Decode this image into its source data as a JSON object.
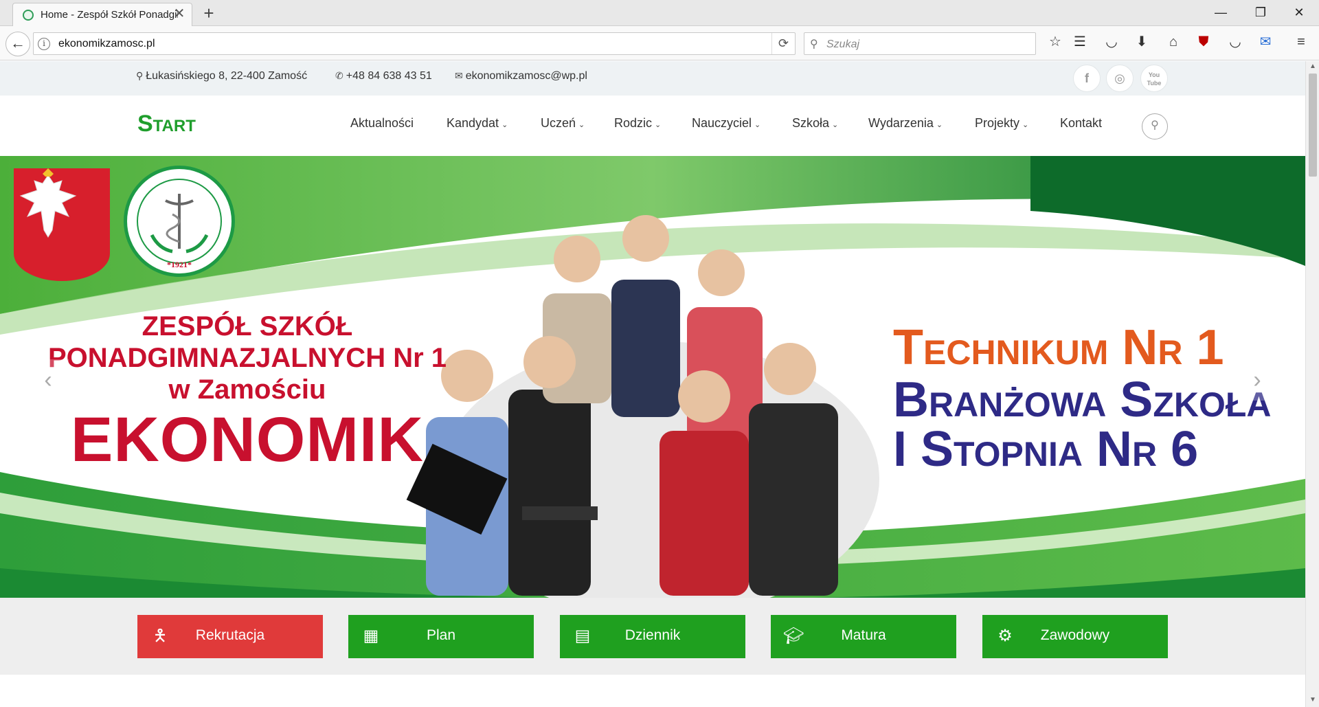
{
  "browser": {
    "tab_title": "Home - Zespół Szkół Ponadgimnazjalnych",
    "tab_close": "✕",
    "new_tab": "+",
    "url": "ekonomikzamosc.pl",
    "search_placeholder": "Szukaj",
    "win_min": "—",
    "win_max": "❐",
    "win_close": "✕"
  },
  "contact": {
    "address": "Łukasińskiego 8, 22-400 Zamość",
    "phone": "+48 84 638 43 51",
    "email": "ekonomikzamosc@wp.pl"
  },
  "social": {
    "facebook": "f",
    "instagram": "◎",
    "youtube": "You Tube"
  },
  "nav": {
    "logo": "Start",
    "items": [
      {
        "label": "Aktualności"
      },
      {
        "label": "Kandydat"
      },
      {
        "label": "Uczeń"
      },
      {
        "label": "Rodzic"
      },
      {
        "label": "Nauczyciel"
      },
      {
        "label": "Szkoła"
      },
      {
        "label": "Wydarzenia"
      },
      {
        "label": "Projekty"
      },
      {
        "label": "Kontakt"
      }
    ]
  },
  "hero": {
    "left_line1": "ZESPÓŁ SZKÓŁ",
    "left_line2": "PONADGIMNAZJALNYCH Nr 1",
    "left_line3": "w Zamościu",
    "left_big": "EKONOMIK",
    "right_line1": "Technikum Nr 1",
    "right_line2": "Branżowa Szkoła",
    "right_line3": "I Stopnia Nr 6",
    "seal_year": "*1921*",
    "prev_arrow": "‹",
    "next_arrow": "›"
  },
  "quick_links": [
    {
      "label": "Rekrutacja",
      "icon": "child-icon",
      "color": "#e03a3a"
    },
    {
      "label": "Plan",
      "icon": "calendar-icon",
      "color": "#1fa01f"
    },
    {
      "label": "Dziennik",
      "icon": "book-icon",
      "color": "#1fa01f"
    },
    {
      "label": "Matura",
      "icon": "graduation-cap-icon",
      "color": "#1fa01f"
    },
    {
      "label": "Zawodowy",
      "icon": "gear-icon",
      "color": "#1fa01f"
    }
  ],
  "colors": {
    "brand_green": "#1fa01f",
    "brand_red": "#c8102e",
    "accent_orange": "#e35a1e",
    "accent_navy": "#2e2a86"
  }
}
